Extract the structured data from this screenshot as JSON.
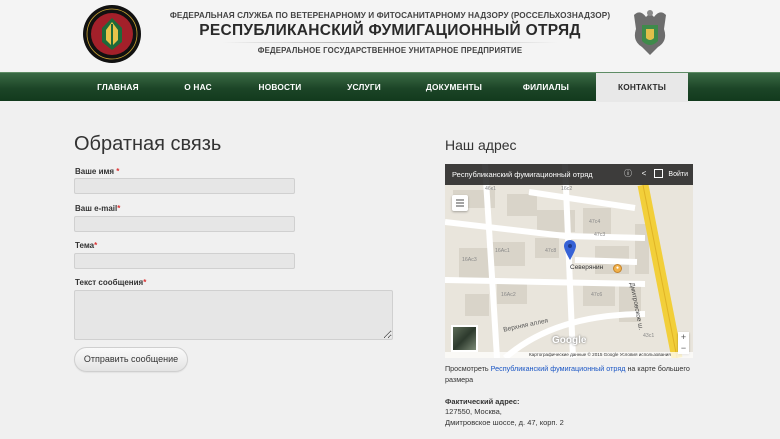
{
  "header": {
    "agency": "ФЕДЕРАЛЬНАЯ СЛУЖБА ПО ВЕТЕРЕНАРНОМУ И ФИТОСАНИТАРНОМУ НАДЗОРУ (РОССЕЛЬХОЗНАДЗОР)",
    "title": "РЕСПУБЛИКАНСКИЙ ФУМИГАЦИОННЫЙ ОТРЯД",
    "subtitle": "ФЕДЕРАЛЬНОЕ ГОСУДАРСТВЕННОЕ УНИТАРНОЕ ПРЕДПРИЯТИЕ",
    "logo_text": "РОССЕЛЬХОЗНАДЗОР"
  },
  "nav": {
    "items": [
      {
        "label": "ГЛАВНАЯ"
      },
      {
        "label": "О НАС"
      },
      {
        "label": "НОВОСТИ"
      },
      {
        "label": "УСЛУГИ"
      },
      {
        "label": "ДОКУМЕНТЫ"
      },
      {
        "label": "ФИЛИАЛЫ"
      },
      {
        "label": "КОНТАКТЫ"
      }
    ],
    "active": "КОНТАКТЫ"
  },
  "form": {
    "title": "Обратная связь",
    "name_label": "Ваше имя",
    "name_req": " *",
    "email_label": "Ваш e-mail",
    "email_req": "*",
    "subject_label": "Тема",
    "subject_req": "*",
    "message_label": "Текст сообщения",
    "message_req": "*",
    "name_value": "",
    "email_value": "",
    "subject_value": "",
    "message_value": "",
    "submit_label": "Отправить сообщение"
  },
  "address": {
    "title": "Наш адрес",
    "map": {
      "bar_title": "Республиканский фумигационный отряд",
      "login": "Войти",
      "footer": "Картографические данные © 2015 Google     Условия использования",
      "street_1": "Верхняя аллея",
      "street_2": "Дмитровское ш.",
      "place": "Северянин",
      "google": "Google",
      "labels": [
        "46к1",
        "47с4",
        "47с3",
        "16Ас3",
        "16Ас1",
        "47с6",
        "43с1",
        "16Ас2",
        "47с8",
        "16с2"
      ]
    },
    "view_prefix": "Просмотреть ",
    "view_link": "Республиканский фумигационный отряд",
    "view_suffix": " на карте большего размера",
    "fact_label": "Фактический адрес:",
    "fact_line1": "127550, Москва,",
    "fact_line2": "Дмитровское шоссе, д. 47, корп. 2"
  },
  "colors": {
    "nav_green": "#1c4527",
    "required": "#d33333",
    "link": "#1a56c5"
  }
}
